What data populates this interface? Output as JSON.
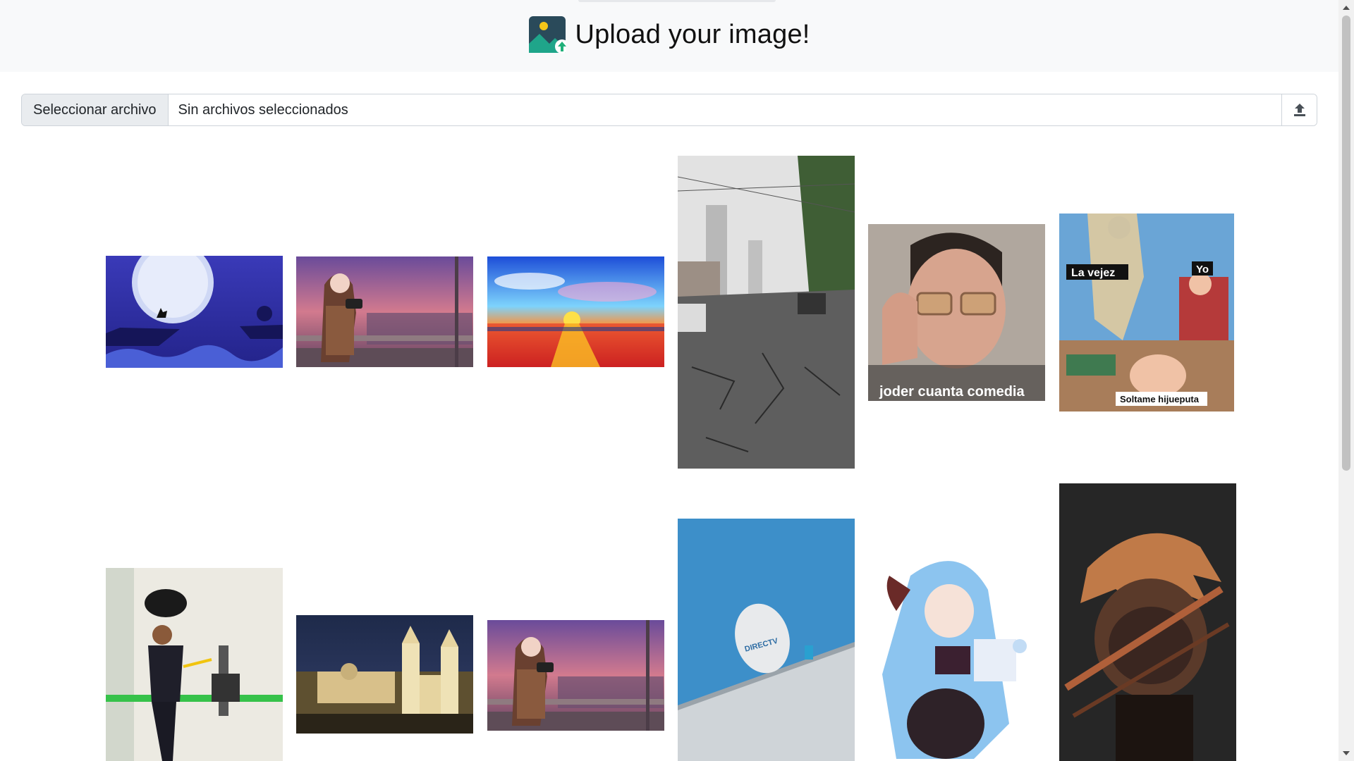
{
  "header": {
    "title": "Upload your image!",
    "icon": "image-upload-icon"
  },
  "upload_form": {
    "choose_label": "Seleccionar archivo",
    "status_text": "Sin archivos seleccionados",
    "submit_icon": "upload-arrow-icon"
  },
  "gallery": {
    "images": [
      {
        "name": "wolf-moon-image"
      },
      {
        "name": "anime-girl-camera-image"
      },
      {
        "name": "sunset-sea-image"
      },
      {
        "name": "street-cracked-road-image"
      },
      {
        "name": "meme-glasses-image",
        "caption": "joder cuanta comedia"
      },
      {
        "name": "meme-old-age-image",
        "labels": [
          "La vejez",
          "Yo",
          "Soltame hijueputa"
        ]
      },
      {
        "name": "welder-boy-image"
      },
      {
        "name": "cathedral-night-image"
      },
      {
        "name": "anime-girl-camera-image-2"
      },
      {
        "name": "satellite-dish-image",
        "brand_text": "DIRECTV"
      },
      {
        "name": "anime-girl-blue-hair-image"
      },
      {
        "name": "dark-anime-character-image"
      }
    ]
  },
  "colors": {
    "header_bg": "#f8f9fa",
    "button_bg": "#e9ecef",
    "border": "#ced4da"
  }
}
